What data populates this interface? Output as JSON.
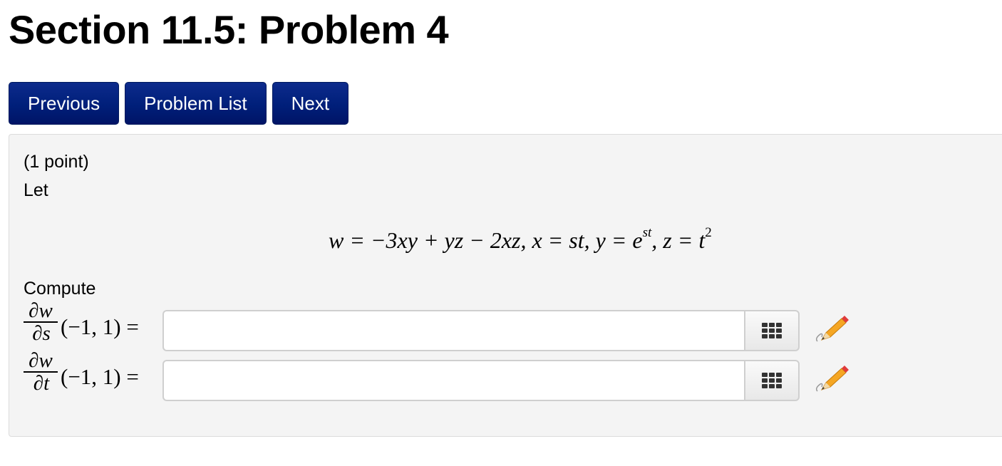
{
  "header": {
    "title": "Section 11.5: Problem 4"
  },
  "nav": {
    "previous_label": "Previous",
    "problem_list_label": "Problem List",
    "next_label": "Next",
    "button_color": "#001f7a"
  },
  "problem": {
    "points": "(1 point)",
    "intro": "Let",
    "equation": {
      "w_def": "w = −3xy + yz − 2xz,",
      "x_def": "x = st,",
      "y_def_base": "y = e",
      "y_def_exp": "st",
      "z_def_base": ", z = t",
      "z_def_exp": "2"
    },
    "compute_label": "Compute",
    "answers": [
      {
        "numerator": "∂w",
        "denominator": "∂s",
        "point": "(−1, 1) =",
        "value": "",
        "keypad_icon": "keypad-icon",
        "edit_icon": "pencil-icon"
      },
      {
        "numerator": "∂w",
        "denominator": "∂t",
        "point": "(−1, 1) =",
        "value": "",
        "keypad_icon": "keypad-icon",
        "edit_icon": "pencil-icon"
      }
    ]
  }
}
